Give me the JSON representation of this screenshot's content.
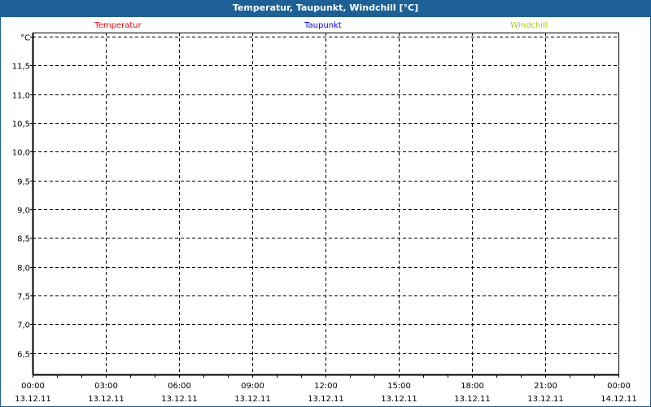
{
  "window": {
    "title": "Temperatur, Taupunkt, Windchill [°C]"
  },
  "chart_data": {
    "type": "line",
    "title": "Temperatur, Taupunkt, Windchill [°C]",
    "ylabel": "°C",
    "ylim": [
      6.13,
      12.07
    ],
    "yticks": [
      6.5,
      7.0,
      7.5,
      8.0,
      8.5,
      9.0,
      9.5,
      10.0,
      10.5,
      11.0,
      11.5,
      12.0
    ],
    "ytick_labels": [
      "6,5",
      "7,0",
      "7,5",
      "8,0",
      "8,5",
      "9,0",
      "9,5",
      "10,0",
      "10,5",
      "11,0",
      "11,5",
      "°C"
    ],
    "xlim_hours": [
      0,
      24
    ],
    "xticks_hours": [
      0,
      3,
      6,
      9,
      12,
      15,
      18,
      21,
      24
    ],
    "xtick_labels": [
      [
        "00:00",
        "13.12.11"
      ],
      [
        "03:00",
        "13.12.11"
      ],
      [
        "06:00",
        "13.12.11"
      ],
      [
        "09:00",
        "13.12.11"
      ],
      [
        "12:00",
        "13.12.11"
      ],
      [
        "15:00",
        "13.12.11"
      ],
      [
        "18:00",
        "13.12.11"
      ],
      [
        "21:00",
        "13.12.11"
      ],
      [
        "00:00",
        "14.12.11"
      ]
    ],
    "grid": true,
    "legend_placement": "top",
    "series": [
      {
        "name": "Temperatur",
        "color": "#ff0000",
        "values": []
      },
      {
        "name": "Taupunkt",
        "color": "#0000ff",
        "values": []
      },
      {
        "name": "Windchill",
        "color": "#a0d000",
        "values": []
      }
    ]
  }
}
